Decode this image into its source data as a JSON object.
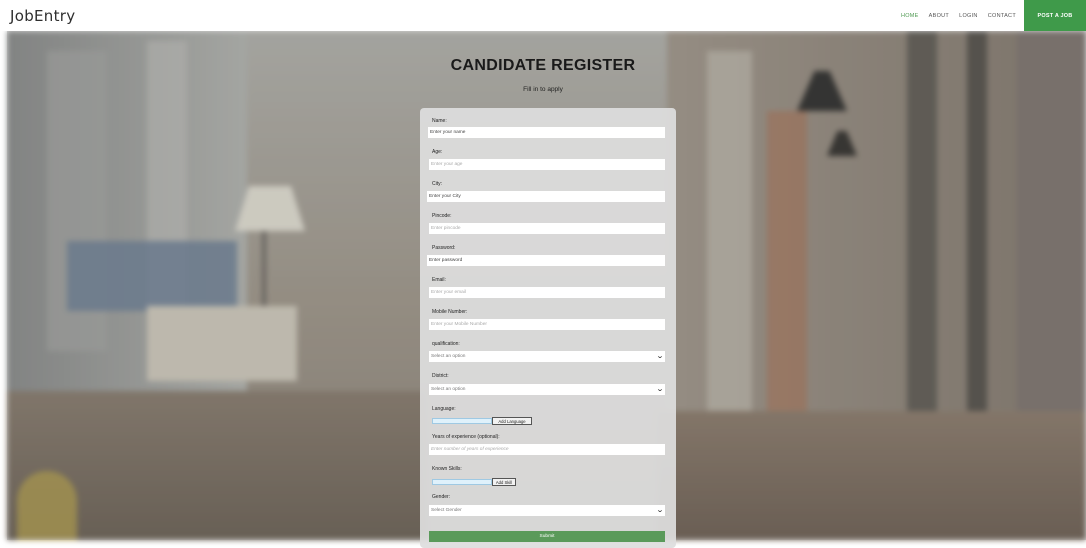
{
  "header": {
    "logo": "JobEntry",
    "nav": [
      "HOME",
      "ABOUT",
      "LOGIN",
      "CONTACT"
    ],
    "post_job": "POST A JOB",
    "accent_color": "#3f9a4a"
  },
  "page": {
    "title": "CANDIDATE REGISTER",
    "subtitle": "Fill in to apply"
  },
  "form": {
    "name": {
      "label": "Name:",
      "placeholder": "Enter your name"
    },
    "age": {
      "label": "Age:",
      "placeholder": "Enter your age"
    },
    "city": {
      "label": "City:",
      "placeholder": "Enter your City"
    },
    "pincode": {
      "label": "Pincode:",
      "placeholder": "Enter pincode"
    },
    "password": {
      "label": "Password:",
      "placeholder": "Enter password"
    },
    "email": {
      "label": "Email:",
      "placeholder": "Enter your email"
    },
    "mobile": {
      "label": "Mobile Number:",
      "placeholder": "Enter your Mobile Number"
    },
    "qualification": {
      "label": "qualification:",
      "selected": "Select an option"
    },
    "district": {
      "label": "District:",
      "selected": "Select an option"
    },
    "language": {
      "label": "Language:",
      "button": "Add Language"
    },
    "experience": {
      "label": "Years of experience (optional):",
      "placeholder": "Enter number of years of experience"
    },
    "skills": {
      "label": "Known Skills:",
      "button": "Add Skill"
    },
    "gender": {
      "label": "Gender:",
      "selected": "Select Gender"
    },
    "submit": "Submit"
  }
}
